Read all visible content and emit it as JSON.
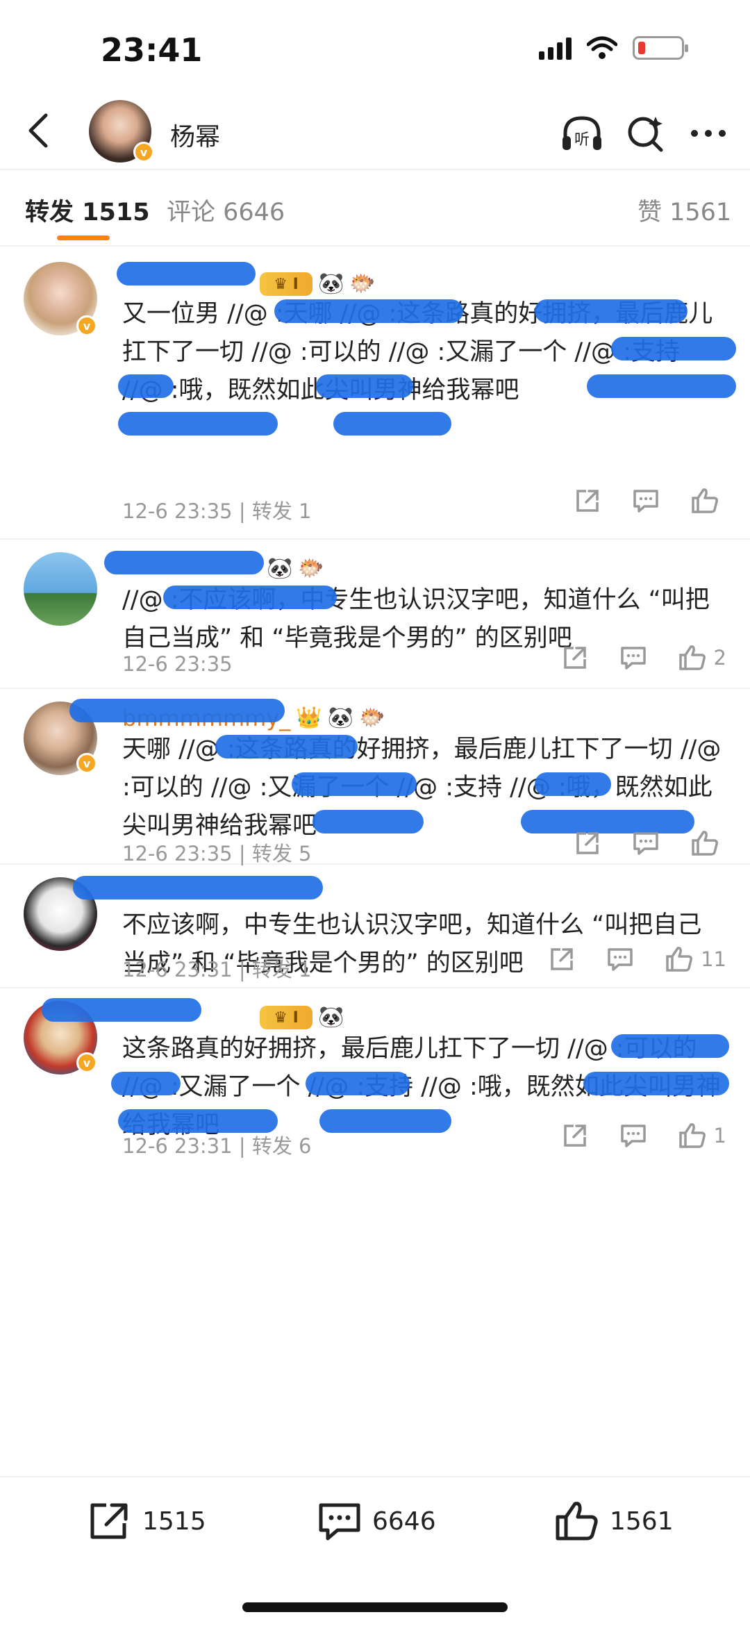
{
  "status_bar": {
    "time": "23:41"
  },
  "nav": {
    "title": "杨幂"
  },
  "tabs": [
    {
      "label": "转发 1515"
    },
    {
      "label": "评论 6646"
    },
    {
      "label": "赞 1561"
    }
  ],
  "comments": [
    {
      "name": "",
      "text": "又一位男 //@ :天哪 //@ :这条路真的好拥挤，最后鹿儿扛下了一切 //@ :可以的 //@ :又漏了一个 //@ :支持 //@ :哦，既然如此尖叫男神给我幂吧",
      "meta": "12-6 23:35 | 转发 1",
      "likes": ""
    },
    {
      "name": "",
      "text": "//@ :不应该啊，中专生也认识汉字吧，知道什么 “叫把自己当成” 和 “毕竟我是个男的” 的区别吧",
      "meta": "12-6 23:35",
      "likes": "2"
    },
    {
      "name": "bmmmmmmy_",
      "text": "天哪 //@ :这条路真的好拥挤，最后鹿儿扛下了一切 //@ :可以的 //@ :又漏了一个 //@ :支持 //@ :哦，既然如此尖叫男神给我幂吧",
      "meta": "12-6 23:35 | 转发 5",
      "likes": ""
    },
    {
      "name": "",
      "text": "不应该啊，中专生也认识汉字吧，知道什么 “叫把自己当成” 和 “毕竟我是个男的” 的区别吧",
      "meta": "12-6 23:31 | 转发 1",
      "likes": "11"
    },
    {
      "name": "",
      "text": "这条路真的好拥挤，最后鹿儿扛下了一切 //@ :可以的 //@ :又漏了一个 //@ :支持 //@ :哦，既然如此尖叫男神给我幂吧",
      "meta": "12-6 23:31 | 转发 6",
      "likes": "1"
    }
  ],
  "bottom_bar": {
    "repost": "1515",
    "comment": "6646",
    "like": "1561"
  },
  "colors": {
    "accent": "#ff8200",
    "name": "#e07a1f",
    "censor": "#1f6fe6"
  }
}
